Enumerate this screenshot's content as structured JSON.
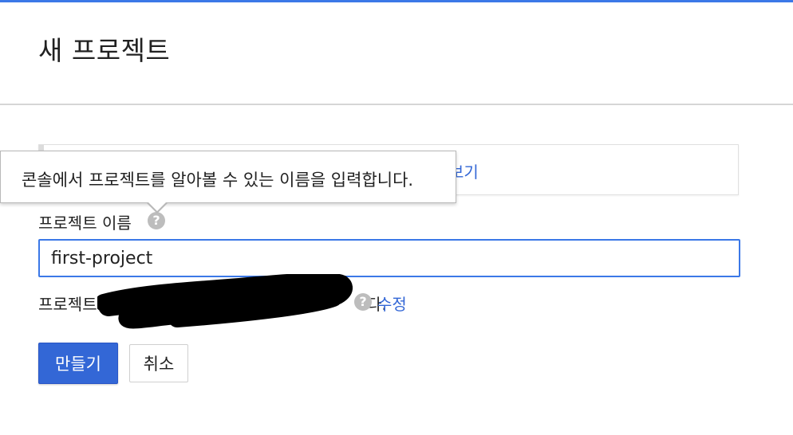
{
  "dialog": {
    "title": "새 프로젝트"
  },
  "info_box": {
    "link_text": "보기"
  },
  "tooltip": {
    "text": "콘솔에서 프로젝트를 알아볼 수 있는 이름을 입력합니다."
  },
  "project_name": {
    "label": "프로젝트 이름",
    "help_icon": "help-circle-icon",
    "value": "first-project"
  },
  "project_id": {
    "prefix": "프로젝트 ID",
    "suffix": "다.",
    "help_icon": "help-circle-icon",
    "edit_label": "수정"
  },
  "actions": {
    "create_label": "만들기",
    "cancel_label": "취소"
  },
  "colors": {
    "accent": "#3367d6",
    "focus_border": "#3b78e7",
    "help_icon": "#bdbdbd"
  }
}
